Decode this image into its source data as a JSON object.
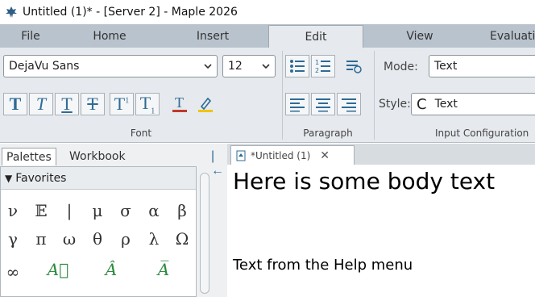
{
  "window": {
    "title": "Untitled (1)* - [Server 2] - Maple 2026"
  },
  "menu_tabs": [
    {
      "label": "File"
    },
    {
      "label": "Home"
    },
    {
      "label": "Insert"
    },
    {
      "label": "Edit"
    },
    {
      "label": "View"
    },
    {
      "label": "Evaluati"
    }
  ],
  "ribbon": {
    "font": {
      "family": "DejaVu Sans",
      "size": "12",
      "group_label": "Font",
      "buttons": [
        "bold-icon",
        "italic-icon",
        "underline-icon",
        "strikethrough-icon",
        "superscript-icon",
        "subscript-icon",
        "text-color-icon",
        "highlight-icon"
      ]
    },
    "paragraph": {
      "group_label": "Paragraph",
      "buttons": [
        "bullet-list-icon",
        "numbered-list-icon",
        "paragraph-format-icon",
        "align-left-icon",
        "align-center-icon",
        "align-right-icon"
      ]
    },
    "input_configuration": {
      "group_label": "Input Configuration",
      "mode_label": "Mode:",
      "mode_value": "Text",
      "style_label": "Style:",
      "style_prefix": "C",
      "style_value": "Text"
    }
  },
  "left_panel": {
    "tabs": [
      {
        "label": "Palettes"
      },
      {
        "label": "Workbook"
      }
    ],
    "collapse_glyph": "|←",
    "favorites": {
      "title": "Favorites",
      "row1": [
        "ν",
        "𝔼",
        "|",
        "μ",
        "σ",
        "α",
        "β"
      ],
      "row2": [
        "γ",
        "π",
        "ω",
        "θ",
        "ρ",
        "λ",
        "Ω"
      ],
      "row3": [
        "∞",
        "A⃗",
        "Â",
        "A̅"
      ]
    }
  },
  "document": {
    "tab_label": "*Untitled (1)",
    "close_glyph": "✕",
    "heading": "Here is some body text",
    "paragraph": "Text from the Help menu"
  },
  "colors": {
    "accent": "#2f6b95",
    "tabbar": "#b9c3cd",
    "ribbon": "#e6e9ed",
    "green": "#2b8a3e"
  }
}
